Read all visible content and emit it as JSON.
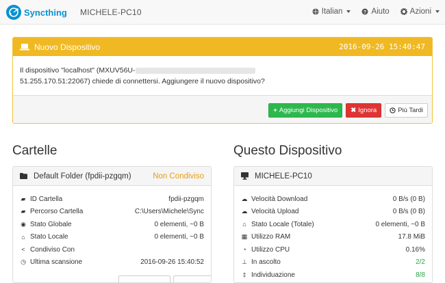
{
  "navbar": {
    "brand": "Syncthing",
    "device": "MICHELE-PC10",
    "language": "Italian",
    "help": "Aiuto",
    "actions": "Azioni"
  },
  "notice": {
    "title": "Nuovo Dispositivo",
    "time": "2016-09-26 15:40:47",
    "line1_prefix": "Il dispositivo \"localhost\" (MXUV56U-",
    "line2": "51.255.170.51:22067) chiede di connettersi. Aggiungere il nuovo dispositivo?",
    "buttons": {
      "add": "Aggiungi Dispositivo",
      "ignore": "Ignora",
      "later": "Più Tardi"
    }
  },
  "folders": {
    "heading": "Cartelle",
    "folder_name": "Default Folder (fpdii-pzgqm)",
    "folder_status": "Non Condiviso",
    "rows": [
      {
        "label": "ID Cartella",
        "value": "fpdii-pzgqm",
        "icon": "folder-icon"
      },
      {
        "label": "Percorso Cartella",
        "value": "C:\\Users\\Michele\\Sync",
        "icon": "folder-open-icon"
      },
      {
        "label": "Stato Globale",
        "value": "0 elementi, ~0 B",
        "icon": "globe-icon"
      },
      {
        "label": "Stato Locale",
        "value": "0 elementi, ~0 B",
        "icon": "home-icon"
      },
      {
        "label": "Condiviso Con",
        "value": "",
        "icon": "share-icon"
      },
      {
        "label": "Ultima scansione",
        "value": "2016-09-26 15:40:52",
        "icon": "clock-icon"
      }
    ]
  },
  "device": {
    "heading": "Questo Dispositivo",
    "name": "MICHELE-PC10",
    "rows": [
      {
        "label": "Velocità Download",
        "value": "0 B/s (0 B)",
        "icon": "cloud-download-icon"
      },
      {
        "label": "Velocità Upload",
        "value": "0 B/s (0 B)",
        "icon": "cloud-upload-icon"
      },
      {
        "label": "Stato Locale (Totale)",
        "value": "0 elementi, ~0 B",
        "icon": "home-icon"
      },
      {
        "label": "Utilizzo RAM",
        "value": "17.8 MiB",
        "icon": "memory-icon"
      },
      {
        "label": "Utilizzo CPU",
        "value": "0.16%",
        "icon": "dashboard-icon"
      },
      {
        "label": "In ascolto",
        "value": "2/2",
        "icon": "sitemap-icon"
      },
      {
        "label": "Individuazione",
        "value": "8/8",
        "icon": "signpost-icon"
      }
    ]
  },
  "colors": {
    "brand": "#0891d1",
    "warning": "#f0b923",
    "success": "#2db84d",
    "danger": "#df3434"
  }
}
